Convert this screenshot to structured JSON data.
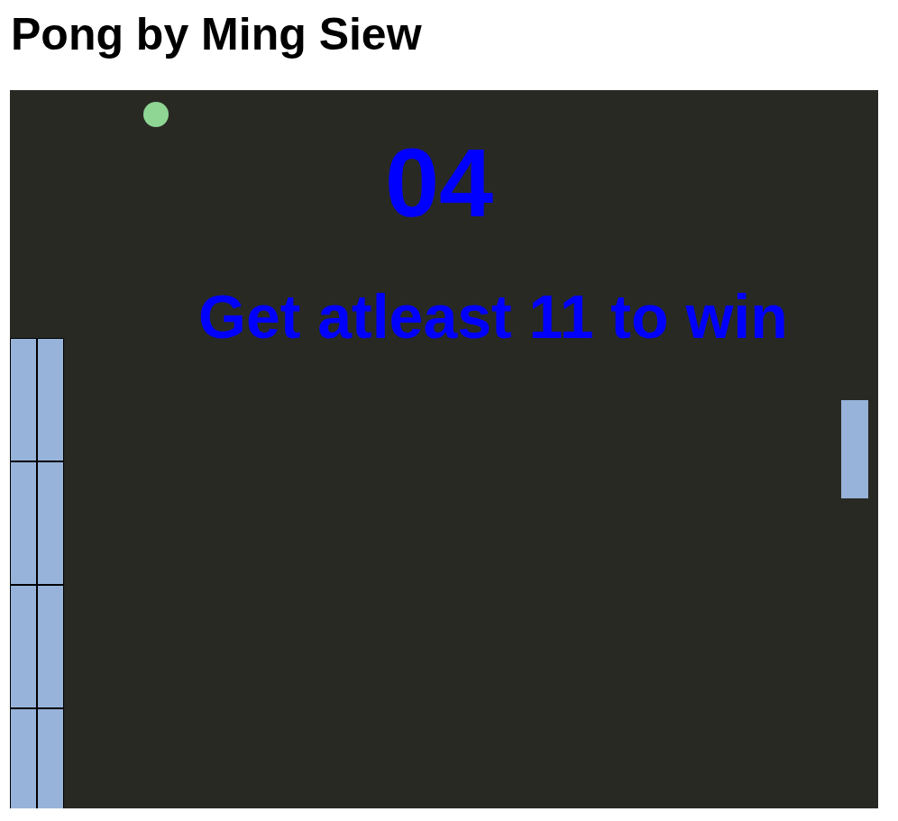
{
  "page": {
    "title": "Pong by Ming Siew"
  },
  "game": {
    "score": "04",
    "message": "Get atleast 11 to win"
  },
  "bricks": [
    {
      "visible": true
    },
    {
      "visible": true
    },
    {
      "visible": true
    },
    {
      "visible": true
    },
    {
      "visible": true
    },
    {
      "visible": true
    },
    {
      "visible": true
    },
    {
      "visible": true
    }
  ]
}
